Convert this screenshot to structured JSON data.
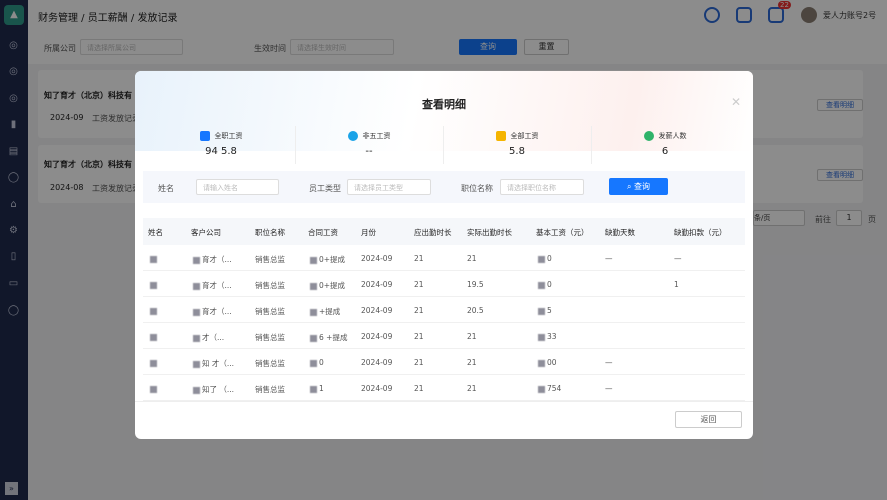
{
  "app": {
    "breadcrumb": "财务管理 / 员工薪酬 / 发放记录",
    "user": "爱人力账号2号",
    "badge": "22"
  },
  "filter": {
    "company_label": "所属公司",
    "company_placeholder": "请选择所属公司",
    "time_label": "生效时间",
    "time_placeholder": "请选择生效时间",
    "search": "查询",
    "reset": "重置"
  },
  "cards": [
    {
      "company": "知了育才（北京）科技有",
      "month": "2024-09",
      "desc": "工资发放记录",
      "view": "查看明细"
    },
    {
      "company": "知了育才（北京）科技有",
      "month": "2024-08",
      "desc": "工资发放记录",
      "view": "查看明细"
    }
  ],
  "pagination": {
    "per_page": "条/页",
    "goto": "前往",
    "page": "1",
    "page_unit": "页"
  },
  "modal": {
    "title": "查看明细",
    "stats": [
      {
        "label": "全职工资",
        "value": "94 5.8",
        "color": "#1677ff"
      },
      {
        "label": "非五工资",
        "value": "--",
        "color": "#1aa3e8"
      },
      {
        "label": "全部工资",
        "value": "5.8",
        "color": "#f5b400"
      },
      {
        "label": "发薪人数",
        "value": "6",
        "color": "#2fb36a"
      }
    ],
    "search": {
      "name_label": "姓名",
      "name_placeholder": "请输入姓名",
      "type_label": "员工类型",
      "type_placeholder": "请选择员工类型",
      "pos_label": "职位名称",
      "pos_placeholder": "请选择职位名称",
      "button": "查询"
    },
    "columns": [
      "姓名",
      "客户公司",
      "职位名称",
      "合同工资",
      "月份",
      "应出勤时长",
      "实际出勤时长",
      "基本工资（元）",
      "缺勤天数",
      "缺勤扣款（元）"
    ],
    "rows": [
      [
        "",
        "育才（...",
        "销售总监",
        "0+提成",
        "2024-09",
        "21",
        "21",
        "0",
        "—",
        "—"
      ],
      [
        "",
        "育才（...",
        "销售总监",
        "0+提成",
        "2024-09",
        "21",
        "19.5",
        "0",
        "",
        "1"
      ],
      [
        "",
        "育才（...",
        "销售总监",
        "+提成",
        "2024-09",
        "21",
        "20.5",
        "5",
        "",
        ""
      ],
      [
        "",
        "才（...",
        "销售总监",
        "6 +提成",
        "2024-09",
        "21",
        "21",
        "33",
        "",
        ""
      ],
      [
        "",
        "知 才（...",
        "销售总监",
        "0",
        "2024-09",
        "21",
        "21",
        "00",
        "—",
        ""
      ],
      [
        "",
        "知了 （...",
        "销售总监",
        "1",
        "2024-09",
        "21",
        "21",
        "754",
        "—",
        ""
      ]
    ],
    "back": "返回"
  }
}
